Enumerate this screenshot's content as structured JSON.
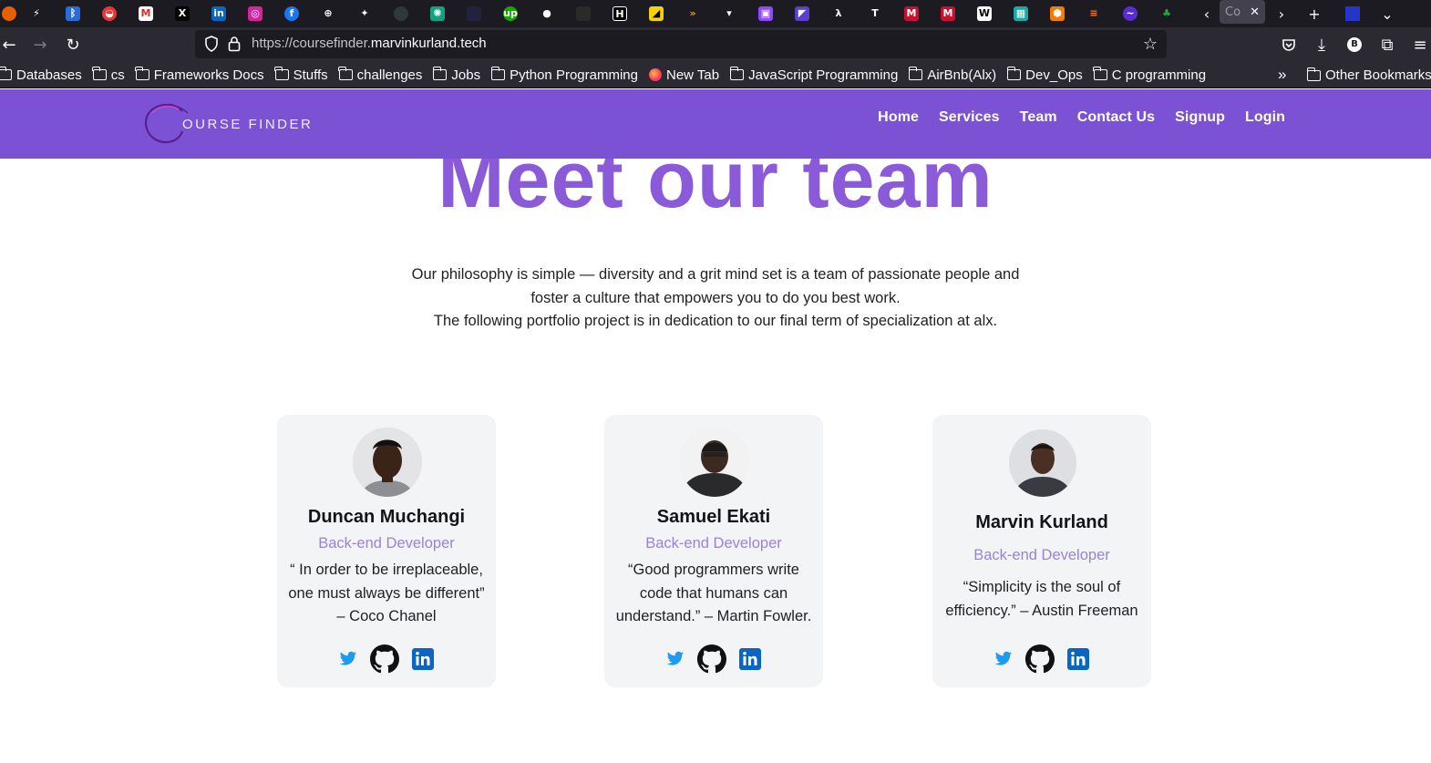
{
  "browser": {
    "active_tab_title": "Co",
    "url_prefix": "https://coursefinder.",
    "url_host": "marvinkurland.tech",
    "bookmarks": [
      {
        "label": "Databases",
        "type": "folder"
      },
      {
        "label": "cs",
        "type": "folder"
      },
      {
        "label": "Frameworks Docs",
        "type": "folder"
      },
      {
        "label": "Stuffs",
        "type": "folder"
      },
      {
        "label": "challenges",
        "type": "folder"
      },
      {
        "label": "Jobs",
        "type": "folder"
      },
      {
        "label": "Python Programming",
        "type": "folder"
      },
      {
        "label": "New Tab",
        "type": "page"
      },
      {
        "label": "JavaScript Programming",
        "type": "folder"
      },
      {
        "label": "AirBnb(Alx)",
        "type": "folder"
      },
      {
        "label": "Dev_Ops",
        "type": "folder"
      },
      {
        "label": "C programming",
        "type": "folder"
      }
    ],
    "other_bookmarks": "Other Bookmarks",
    "account_initial": "B"
  },
  "header": {
    "logo_text": "OURSE FINDER",
    "nav": [
      "Home",
      "Services",
      "Team",
      "Contact Us",
      "Signup",
      "Login"
    ]
  },
  "team": {
    "title": "Meet our team",
    "intro": [
      "Our philosophy is simple — diversity and a grit mind set is a team of passionate people and",
      "foster a culture that empowers you to do you best work.",
      "The following portfolio project is in dedication to our final term of specialization at alx."
    ],
    "members": [
      {
        "name": "Duncan Muchangi",
        "role": "Back-end Developer",
        "quote": [
          "“ In order to be irreplaceable,",
          "one must always be different”",
          "– Coco Chanel"
        ]
      },
      {
        "name": "Samuel Ekati",
        "role": "Back-end Developer",
        "quote": [
          "“Good programmers write",
          "code that humans can",
          "understand.” – Martin Fowler."
        ]
      },
      {
        "name": "Marvin Kurland",
        "role": "Back-end Developer",
        "quote": [
          "“Simplicity is the soul of",
          "efficiency.” – Austin Freeman"
        ]
      }
    ]
  },
  "colors": {
    "brand_purple": "#7b52d4",
    "title_purple": "#8a5ad8",
    "role_purple": "#9b82d8",
    "twitter_blue": "#1d9bf0",
    "linkedin_blue": "#0a66c2"
  }
}
